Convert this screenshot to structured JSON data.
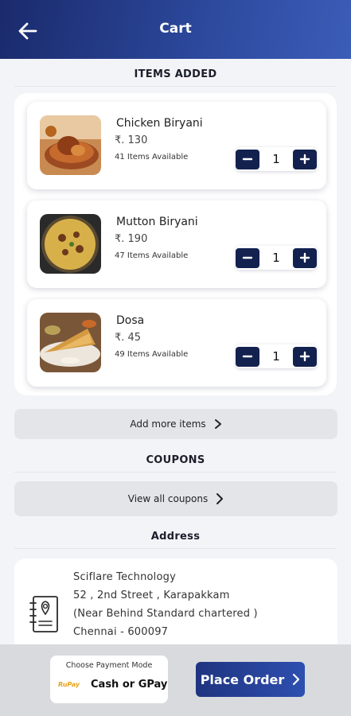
{
  "header": {
    "title": "Cart"
  },
  "sections": {
    "items_added": "ITEMS ADDED",
    "coupons": "COUPONS",
    "address": "Address"
  },
  "items": [
    {
      "name": "Chicken Biryani",
      "price": "₹. 130",
      "availability": "41 Items Available",
      "quantity": "1",
      "image": "chicken-biryani-photo"
    },
    {
      "name": "Mutton Biryani",
      "price": "₹. 190",
      "availability": "47 Items Available",
      "quantity": "1",
      "image": "mutton-biryani-photo"
    },
    {
      "name": "Dosa",
      "price": "₹. 45",
      "availability": "49 Items Available",
      "quantity": "1",
      "image": "dosa-photo"
    }
  ],
  "buttons": {
    "add_more": "Add more items",
    "view_coupons": "View all coupons",
    "place_order": "Place Order"
  },
  "address": {
    "lines": [
      "Sciflare Technology",
      "52 , 2nd Street  , Karapakkam",
      "(Near Behind Standard chartered )",
      "Chennai  - 600097"
    ]
  },
  "payment": {
    "title": "Choose Payment Mode",
    "method": "Cash or GPay",
    "logo_text": "RuPay"
  },
  "colors": {
    "primary": "#1a2a6c",
    "stepper": "#13214f",
    "accent_button": "#2e4fb0"
  }
}
